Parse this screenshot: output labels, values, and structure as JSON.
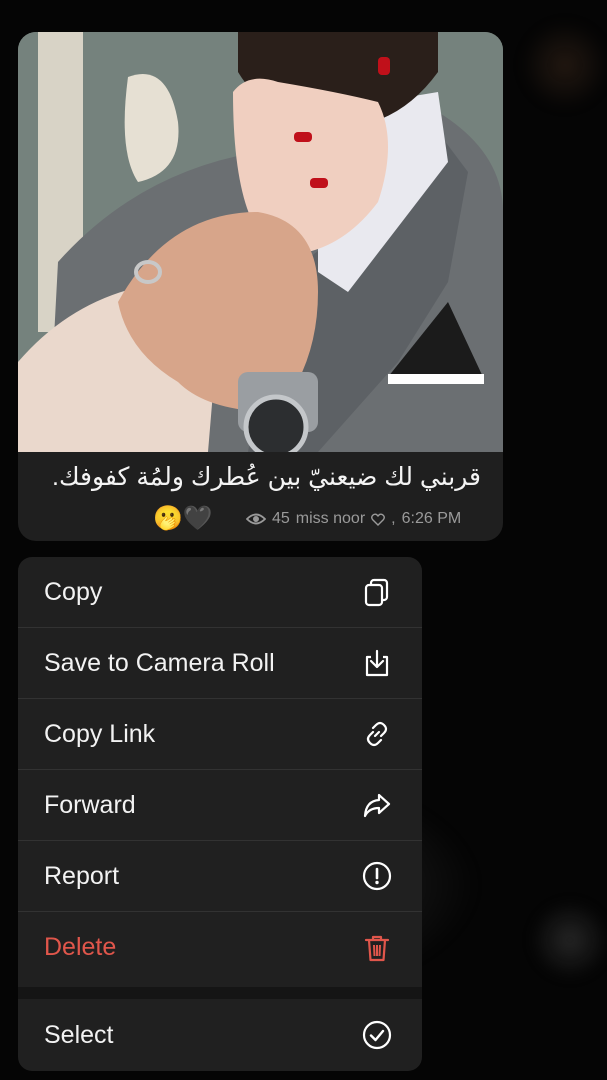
{
  "message": {
    "caption": "قربني لك ضيعنيّ بين عُطرك ولمُة كفوفك.",
    "emojis": "🫢🖤",
    "views": "45",
    "author": "miss noor",
    "time": "6:26 PM",
    "photo_icon": "couple-photo"
  },
  "menu": {
    "items": [
      {
        "label": "Copy",
        "icon": "copy-icon"
      },
      {
        "label": "Save to Camera Roll",
        "icon": "download-icon"
      },
      {
        "label": "Copy Link",
        "icon": "link-icon"
      },
      {
        "label": "Forward",
        "icon": "forward-icon"
      },
      {
        "label": "Report",
        "icon": "report-icon"
      },
      {
        "label": "Delete",
        "icon": "trash-icon",
        "color": "#e0564b"
      },
      {
        "label": "Select",
        "icon": "select-check-icon"
      }
    ]
  },
  "colors": {
    "background": "#050505",
    "menu_bg": "#202020",
    "bubble_bg": "#1f1f1f",
    "destructive": "#e0564b",
    "meta_text": "#9a9a9a"
  }
}
